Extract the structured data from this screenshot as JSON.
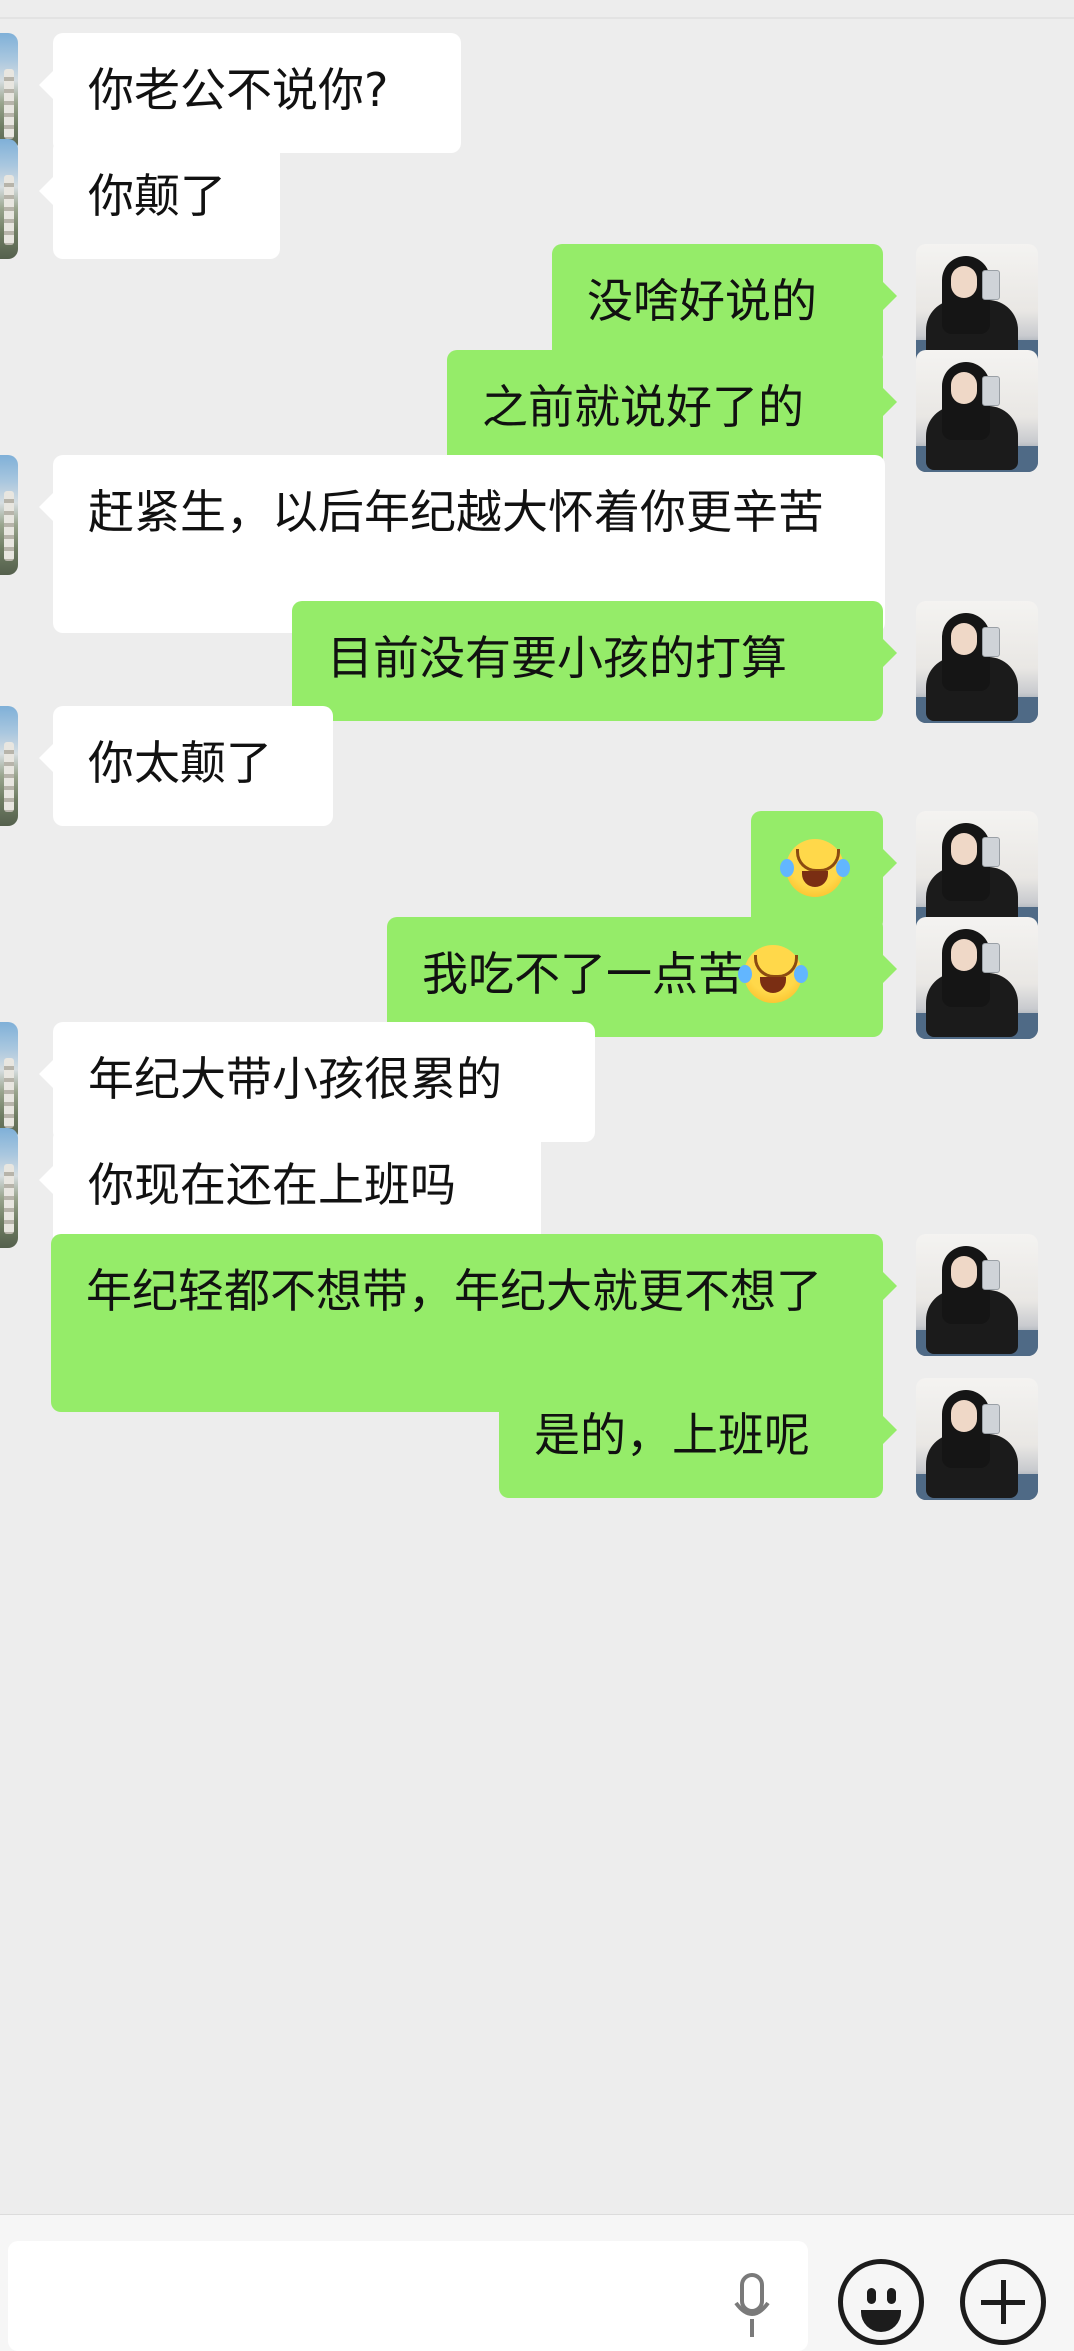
{
  "messages": [
    {
      "side": "left",
      "text": "你老公不说你?"
    },
    {
      "side": "left",
      "text": "你颠了"
    },
    {
      "side": "right",
      "text": "没啥好说的"
    },
    {
      "side": "right",
      "text": "之前就说好了的"
    },
    {
      "side": "left",
      "text": "赶紧生，以后年纪越大怀着你更辛苦"
    },
    {
      "side": "right",
      "text": "目前没有要小孩的打算"
    },
    {
      "side": "left",
      "text": "你太颠了"
    },
    {
      "side": "right",
      "text": "",
      "emoji": "face-with-tears-of-joy"
    },
    {
      "side": "right",
      "text": "我吃不了一点苦",
      "emoji": "face-with-tears-of-joy"
    },
    {
      "side": "left",
      "text": "年纪大带小孩很累的"
    },
    {
      "side": "left",
      "text": "你现在还在上班吗"
    },
    {
      "side": "right",
      "text": "年纪轻都不想带，年纪大就更不想了"
    },
    {
      "side": "right",
      "text": "是的，上班呢"
    }
  ],
  "input": {
    "value": "",
    "icons": [
      "microphone-icon",
      "emoji-icon",
      "plus-icon"
    ]
  },
  "colors": {
    "background": "#ededed",
    "incoming_bubble": "#ffffff",
    "outgoing_bubble": "#95ec69"
  }
}
